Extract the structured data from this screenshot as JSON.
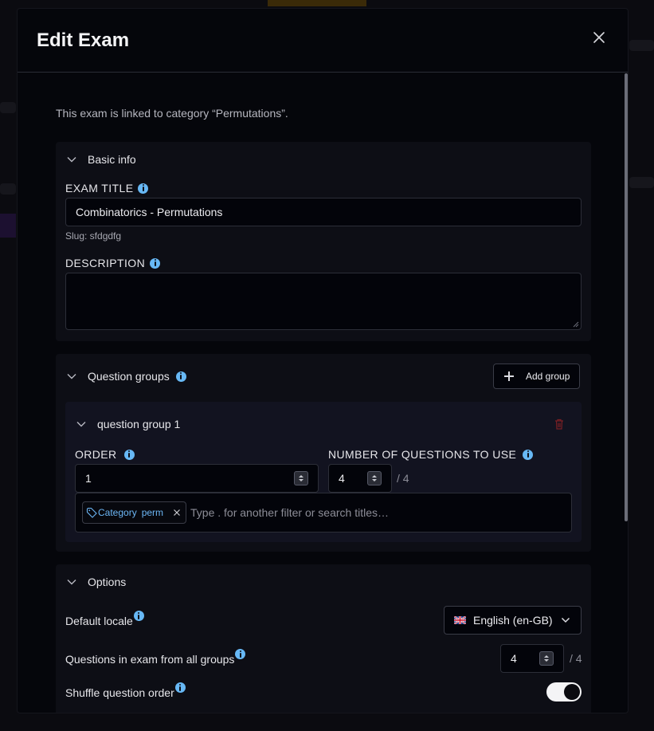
{
  "modal": {
    "title": "Edit Exam",
    "link_note": "This exam is linked to category “Permutations”."
  },
  "basic_info": {
    "title": "Basic info",
    "exam_title_label": "EXAM TITLE",
    "exam_title_value": "Combinatorics - Permutations",
    "slug": "Slug: sfdgdfg",
    "description_label": "DESCRIPTION",
    "description_value": ""
  },
  "question_groups": {
    "title": "Question groups",
    "add_button": "Add group",
    "groups": [
      {
        "name": "question group 1",
        "order_label": "ORDER",
        "order_value": "1",
        "num_label": "NUMBER OF QUESTIONS TO USE",
        "num_value": "4",
        "num_total": "/ 4",
        "filter_tag_key": "Category",
        "filter_tag_value": "perm",
        "filter_placeholder": "Type . for another filter or search titles…"
      }
    ]
  },
  "options": {
    "title": "Options",
    "default_locale_label": "Default locale",
    "default_locale_value": "English (en-GB)",
    "questions_all_label": "Questions in exam from all groups",
    "questions_all_value": "4",
    "questions_all_total": "/ 4",
    "shuffle_label": "Shuffle question order",
    "shuffle_on": true
  },
  "colors": {
    "accent_info": "#67b8f5",
    "tag_text": "#6cb6f5",
    "delete_icon": "#7a1f24"
  }
}
